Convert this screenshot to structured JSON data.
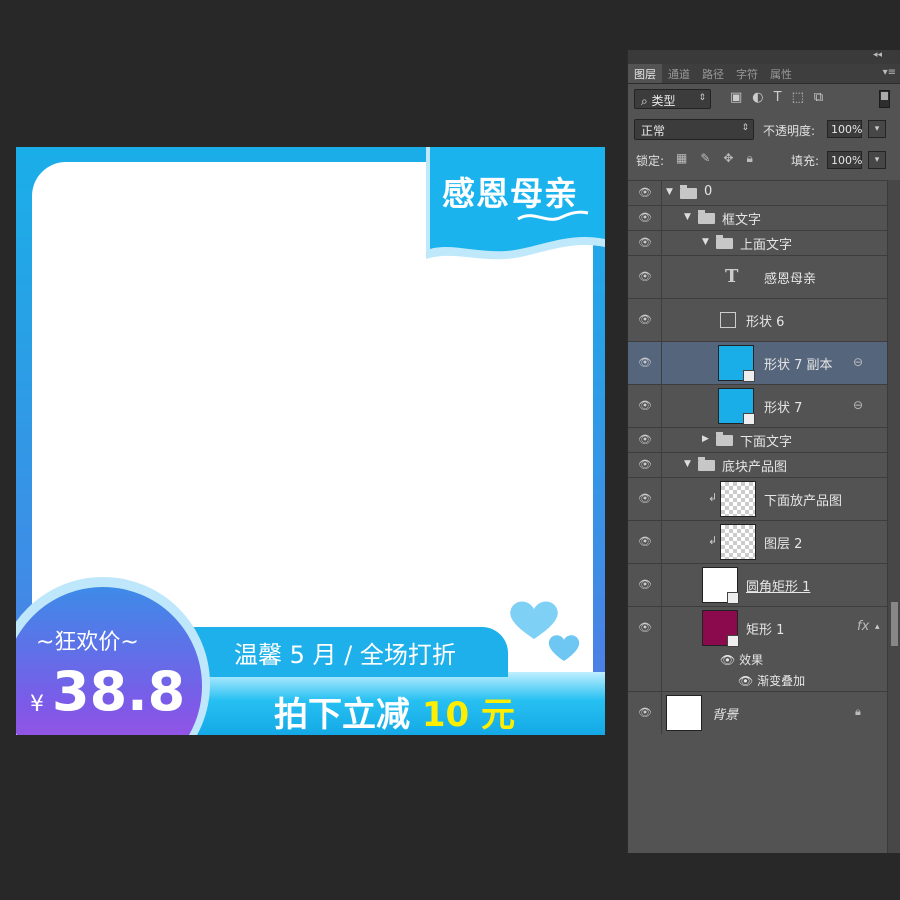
{
  "canvas": {
    "title_part1": "感恩",
    "title_part2": "母亲",
    "badge_label": "~狂欢价~",
    "currency": "¥",
    "price": "38.8",
    "subtitle": "温馨 5 月 / 全场打折",
    "cta_prefix": "拍下立减 ",
    "cta_highlight": "10 元",
    "colors": {
      "primary": "#1aaee8",
      "badge_top": "#3d8be8",
      "badge_bottom": "#b44bdf",
      "highlight": "#ffee00"
    }
  },
  "panel": {
    "tabs": [
      "图层",
      "通道",
      "路径",
      "字符",
      "属性"
    ],
    "active_tab": "图层",
    "filter_kind": "类型",
    "filter_icons": [
      "image-filter-icon",
      "adjustment-filter-icon",
      "type-filter-icon",
      "shape-filter-icon",
      "smart-object-filter-icon"
    ],
    "blend_mode": "正常",
    "opacity_label": "不透明度:",
    "opacity_value": "100%",
    "lock_label": "锁定:",
    "fill_label": "填充:",
    "fill_value": "100%",
    "layers": [
      {
        "name": "0",
        "kind": "group",
        "expanded": true,
        "indent": 0
      },
      {
        "name": "框文字",
        "kind": "group",
        "expanded": true,
        "indent": 1
      },
      {
        "name": "上面文字",
        "kind": "group",
        "expanded": true,
        "indent": 2
      },
      {
        "name": "感恩母亲",
        "kind": "text",
        "indent": 3
      },
      {
        "name": "形状 6",
        "kind": "shape",
        "indent": 3
      },
      {
        "name": "形状 7 副本",
        "kind": "shape",
        "indent": 3,
        "selected": true,
        "linked": true
      },
      {
        "name": "形状 7",
        "kind": "shape",
        "indent": 3,
        "linked": true
      },
      {
        "name": "下面文字",
        "kind": "group",
        "expanded": false,
        "indent": 2
      },
      {
        "name": "底块产品图",
        "kind": "group",
        "expanded": true,
        "indent": 1
      },
      {
        "name": "下面放产品图",
        "kind": "pixel",
        "indent": 2,
        "clipped": true
      },
      {
        "name": "图层 2",
        "kind": "pixel",
        "indent": 2,
        "clipped": true
      },
      {
        "name": "圆角矩形 1",
        "kind": "shape",
        "indent": 2
      },
      {
        "name": "矩形 1",
        "kind": "shape",
        "indent": 2,
        "fx": true
      },
      {
        "name": "效果",
        "kind": "effect-header",
        "indent": 2
      },
      {
        "name": "渐变叠加",
        "kind": "effect",
        "indent": 2
      },
      {
        "name": "背景",
        "kind": "background",
        "indent": 0,
        "locked": true
      }
    ]
  }
}
